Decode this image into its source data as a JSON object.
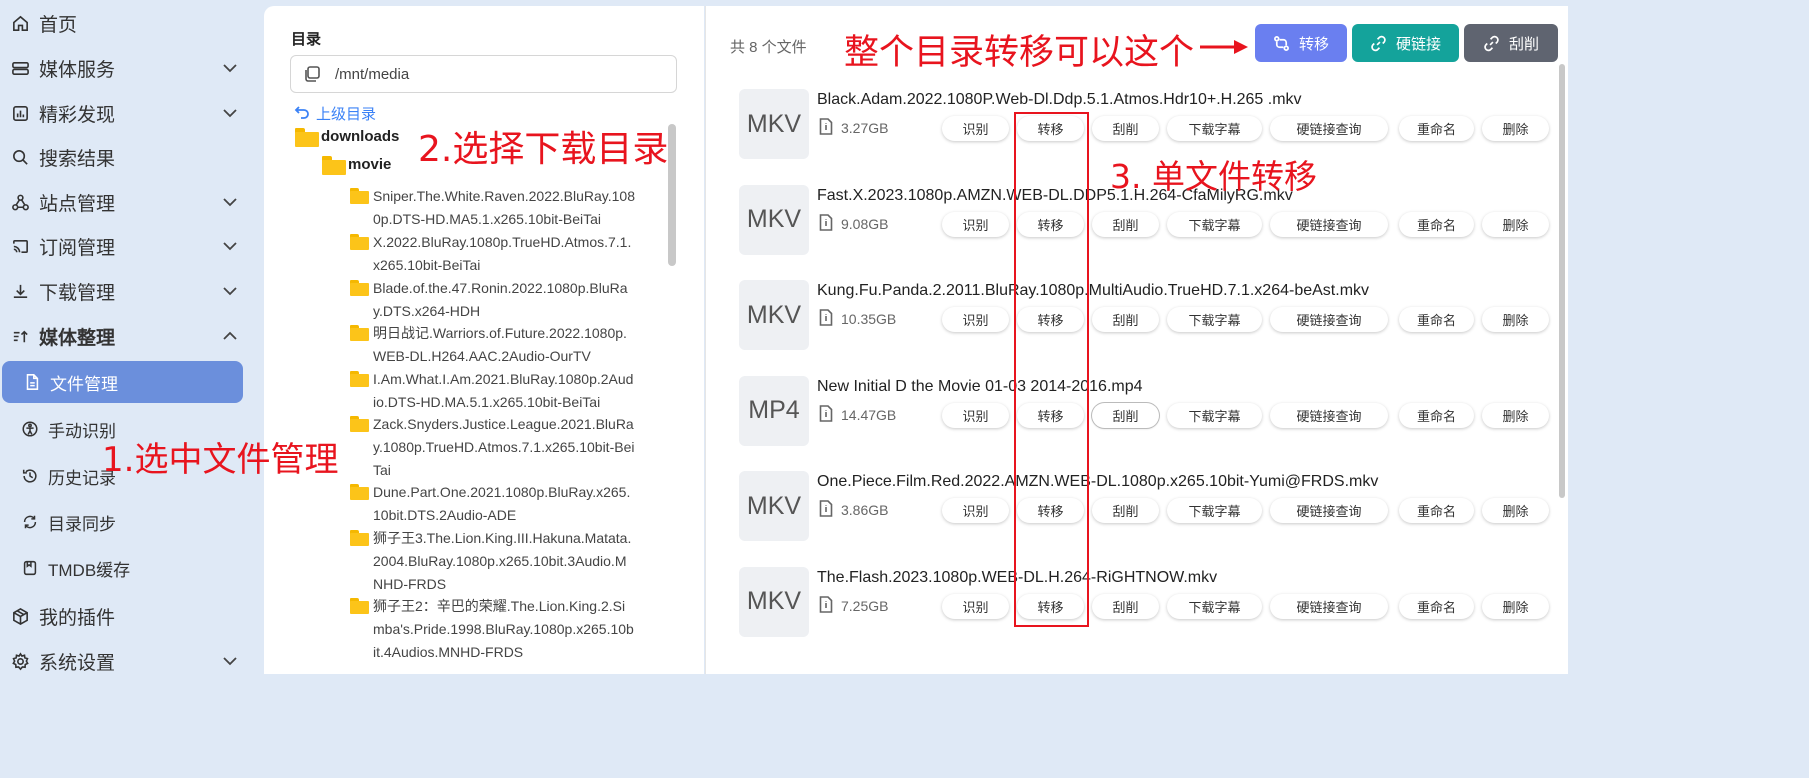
{
  "sidebar": {
    "items": [
      {
        "label": "首页",
        "icon": "home-icon"
      },
      {
        "label": "媒体服务",
        "icon": "server-icon",
        "expandable": true
      },
      {
        "label": "精彩发现",
        "icon": "chart-icon",
        "expandable": true
      },
      {
        "label": "搜索结果",
        "icon": "search-icon"
      },
      {
        "label": "站点管理",
        "icon": "sitemap-icon",
        "expandable": true
      },
      {
        "label": "订阅管理",
        "icon": "cast-icon",
        "expandable": true
      },
      {
        "label": "下载管理",
        "icon": "download-icon",
        "expandable": true
      },
      {
        "label": "媒体整理",
        "icon": "sort-icon",
        "expanded": true
      },
      {
        "label": "我的插件",
        "icon": "package-icon"
      },
      {
        "label": "系统设置",
        "icon": "settings-icon",
        "expandable": true
      }
    ],
    "sub_items": [
      {
        "label": "文件管理",
        "icon": "file-manager-icon",
        "active": true
      },
      {
        "label": "手动识别",
        "icon": "recognize-icon"
      },
      {
        "label": "历史记录",
        "icon": "history-icon"
      },
      {
        "label": "目录同步",
        "icon": "sync-icon"
      },
      {
        "label": "TMDB缓存",
        "icon": "cache-icon"
      }
    ]
  },
  "directory": {
    "title": "目录",
    "path": "/mnt/media",
    "parent_link": "上级目录",
    "root_folder": "downloads",
    "sub_folder": "movie",
    "folders": [
      "Sniper.The.White.Raven.2022.BluRay.1080p.DTS-HD.MA5.1.x265.10bit-BeiTai",
      "X.2022.BluRay.1080p.TrueHD.Atmos.7.1.x265.10bit-BeiTai",
      "Blade.of.the.47.Ronin.2022.1080p.BluRay.DTS.x264-HDH",
      "明日战记.Warriors.of.Future.2022.1080p.WEB-DL.H264.AAC.2Audio-OurTV",
      "I.Am.What.I.Am.2021.BluRay.1080p.2Audio.DTS-HD.MA.5.1.x265.10bit-BeiTai",
      "Zack.Snyders.Justice.League.2021.BluRay.1080p.TrueHD.Atmos.7.1.x265.10bit-BeiTai",
      "Dune.Part.One.2021.1080p.BluRay.x265.10bit.DTS.2Audio-ADE",
      "狮子王3.The.Lion.King.III.Hakuna.Matata.2004.BluRay.1080p.x265.10bit.3Audio.MNHD-FRDS",
      "狮子王2：辛巴的荣耀.The.Lion.King.2.Simba's.Pride.1998.BluRay.1080p.x265.10bit.4Audios.MNHD-FRDS"
    ]
  },
  "files": {
    "count_label": "共 8 个文件",
    "top_buttons": [
      {
        "label": "转移",
        "icon": "transfer-icon",
        "color": "#6a7ff0"
      },
      {
        "label": "硬链接",
        "icon": "link-icon",
        "color": "#14a39b"
      },
      {
        "label": "刮削",
        "icon": "scrape-icon",
        "color": "#5f6470"
      }
    ],
    "actions": [
      "识别",
      "转移",
      "刮削",
      "下载字幕",
      "硬链接查询",
      "重命名",
      "删除"
    ],
    "items": [
      {
        "ext": "MKV",
        "name": "Black.Adam.2022.1080P.Web-Dl.Ddp.5.1.Atmos.Hdr10+.H.265 .mkv",
        "size": "3.27GB"
      },
      {
        "ext": "MKV",
        "name": "Fast.X.2023.1080p.AMZN.WEB-DL.DDP5.1.H.264-CfaMilyRG.mkv",
        "size": "9.08GB"
      },
      {
        "ext": "MKV",
        "name": "Kung.Fu.Panda.2.2011.BluRay.1080p.MultiAudio.TrueHD.7.1.x264-beAst.mkv",
        "size": "10.35GB"
      },
      {
        "ext": "MP4",
        "name": "New Initial D the Movie 01-03 2014-2016.mp4",
        "size": "14.47GB"
      },
      {
        "ext": "MKV",
        "name": "One.Piece.Film.Red.2022.AMZN.WEB-DL.1080p.x265.10bit-Yumi@FRDS.mkv",
        "size": "3.86GB"
      },
      {
        "ext": "MKV",
        "name": "The.Flash.2023.1080p.WEB-DL.H.264-RiGHTNOW.mkv",
        "size": "7.25GB"
      }
    ]
  },
  "annotations": {
    "step1": "1.选中文件管理",
    "step2": "2.选择下载目录",
    "step3": "3. 单文件转移",
    "top_note": "整个目录转移可以这个",
    "color": "#e8141e"
  }
}
